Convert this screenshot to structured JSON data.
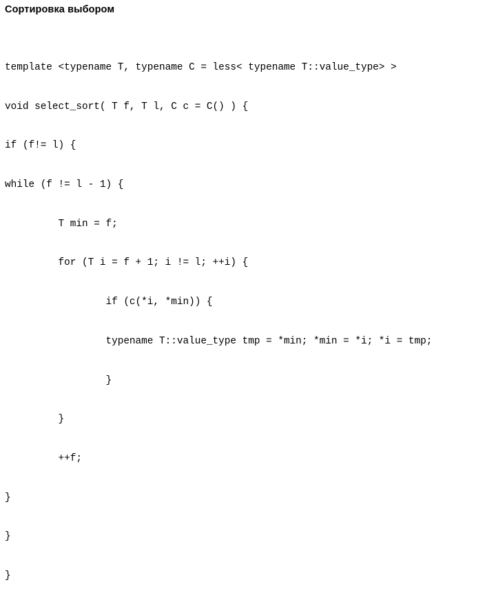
{
  "slide": {
    "title": "Сортировка выбором",
    "background_color": "#ffffff",
    "text_color": "#000000"
  },
  "code": {
    "language": "C++",
    "lines": [
      "template <typename T, typename C = less< typename T::value_type> >",
      "void select_sort( T f, T l, C c = C() ) {",
      "if (f!= l) {",
      "while (f != l - 1) {",
      "         T min = f;",
      "         for (T i = f + 1; i != l; ++i) {",
      "                 if (c(*i, *min)) {",
      "                 typename T::value_type tmp = *min; *min = *i; *i = tmp;",
      "                 }",
      "         }",
      "         ++f;",
      "}",
      "}",
      "}"
    ]
  }
}
